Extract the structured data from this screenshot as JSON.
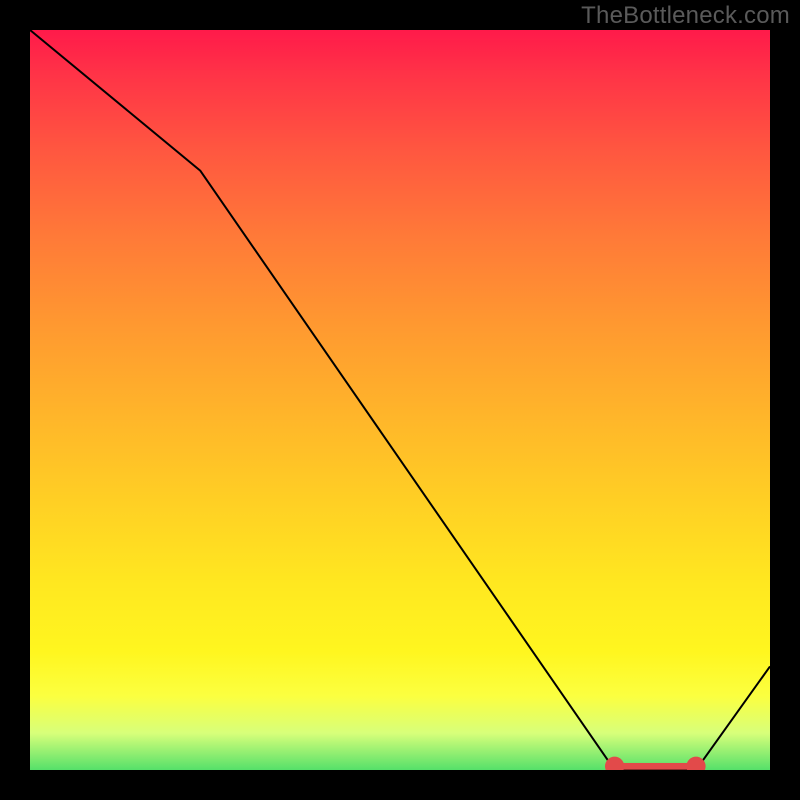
{
  "watermark": "TheBottleneck.com",
  "chart_data": {
    "type": "line",
    "title": "",
    "xlabel": "",
    "ylabel": "",
    "xlim": [
      0,
      100
    ],
    "ylim": [
      0,
      100
    ],
    "grid": false,
    "legend": false,
    "background_gradient": {
      "top": "#ff1a4a",
      "mid": "#ffe820",
      "bottom": "#55e06a"
    },
    "series": [
      {
        "name": "bottleneck-curve",
        "color": "#000000",
        "x": [
          0,
          23,
          79,
          90,
          100
        ],
        "values": [
          100,
          81,
          0,
          0,
          14
        ]
      }
    ],
    "markers": {
      "name": "optimal-range",
      "color": "#e24a4a",
      "y": 0.5,
      "x_range": [
        79,
        90
      ],
      "endpoint_radius": 1.3,
      "band_thickness": 0.9
    }
  }
}
